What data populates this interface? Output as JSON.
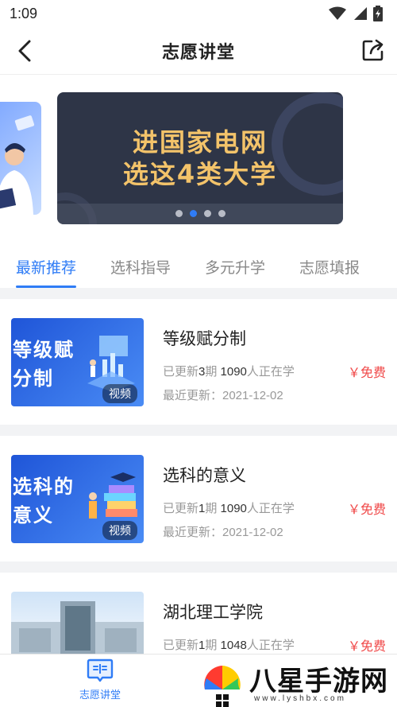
{
  "status_bar": {
    "time": "1:09"
  },
  "header": {
    "title": "志愿讲堂"
  },
  "banner": {
    "line1": "进国家电网",
    "line2": "选这4类大学",
    "dot_count": 4,
    "active_dot": 1
  },
  "tabs": [
    {
      "label": "最新推荐",
      "active": true
    },
    {
      "label": "选科指导",
      "active": false
    },
    {
      "label": "多元升学",
      "active": false
    },
    {
      "label": "志愿填报",
      "active": false
    }
  ],
  "courses": [
    {
      "thumb_line1": "等级赋",
      "thumb_line2": "分制",
      "tag": "视频",
      "title": "等级赋分制",
      "meta_prefix": "已更新",
      "issues": "3",
      "meta_mid": "期 ",
      "learners": "1090",
      "meta_suffix": "人正在学",
      "date": "最近更新：2021-12-02",
      "price": "￥免费"
    },
    {
      "thumb_line1": "选科的",
      "thumb_line2": "意义",
      "tag": "视频",
      "title": "选科的意义",
      "meta_prefix": "已更新",
      "issues": "1",
      "meta_mid": "期 ",
      "learners": "1090",
      "meta_suffix": "人正在学",
      "date": "最近更新：2021-12-02",
      "price": "￥免费"
    },
    {
      "title": "湖北理工学院",
      "meta_prefix": "已更新",
      "issues": "1",
      "meta_mid": "期 ",
      "learners": "1048",
      "meta_suffix": "人正在学",
      "price": "￥免费"
    }
  ],
  "bottom_nav": {
    "label": "志愿讲堂"
  },
  "watermark": {
    "text": "八星手游网",
    "url": "www.lyshbx.com"
  },
  "colors": {
    "accent": "#2f7cf6",
    "price": "#f04848",
    "banner_text": "#f3c36a",
    "banner_bg": "#2e3547"
  }
}
